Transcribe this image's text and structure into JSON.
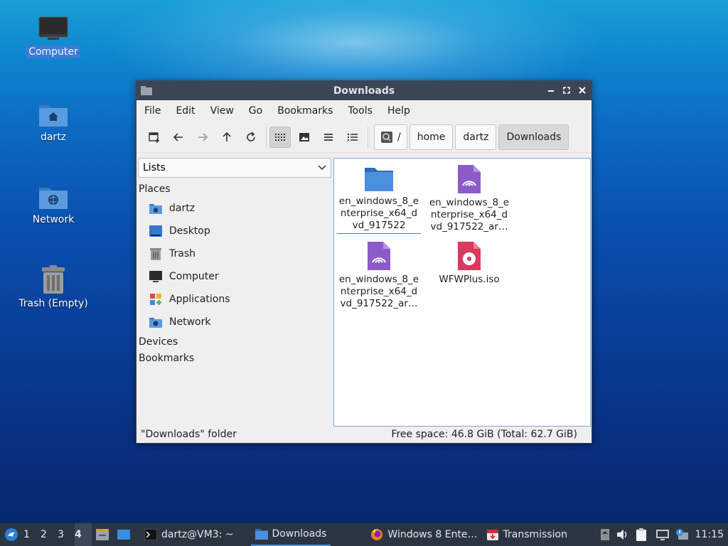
{
  "desktop": {
    "icons": [
      {
        "label": "Computer",
        "icon": "monitor-icon"
      },
      {
        "label": "dartz",
        "icon": "home-folder-icon"
      },
      {
        "label": "Network",
        "icon": "network-folder-icon"
      },
      {
        "label": "Trash (Empty)",
        "icon": "trash-icon"
      }
    ]
  },
  "window": {
    "title": "Downloads",
    "menu": [
      "File",
      "Edit",
      "View",
      "Go",
      "Bookmarks",
      "Tools",
      "Help"
    ],
    "breadcrumb": [
      "/",
      "home",
      "dartz",
      "Downloads"
    ],
    "side_pane": {
      "mode": "Lists",
      "sections": {
        "places": "Places",
        "devices": "Devices",
        "bookmarks": "Bookmarks"
      },
      "places": [
        {
          "label": "dartz",
          "icon": "home-folder-icon"
        },
        {
          "label": "Desktop",
          "icon": "desktop-icon"
        },
        {
          "label": "Trash",
          "icon": "trash-icon"
        },
        {
          "label": "Computer",
          "icon": "monitor-icon"
        },
        {
          "label": "Applications",
          "icon": "applications-icon"
        },
        {
          "label": "Network",
          "icon": "network-folder-icon"
        }
      ]
    },
    "files": [
      {
        "name": "en_windows_8_enterprise_x64_dvd_917522",
        "display": [
          "en_windows_8_e",
          "nterprise_x64_d",
          "vd_917522"
        ],
        "icon": "folder-icon"
      },
      {
        "name": "en_windows_8_enterprise_x64_dvd_917522_ar…",
        "display": [
          "en_windows_8_e",
          "nterprise_x64_d",
          "vd_917522_ar…"
        ],
        "icon": "torrent-icon"
      },
      {
        "name": "en_windows_8_enterprise_x64_dvd_917522_ar…",
        "display": [
          "en_windows_8_e",
          "nterprise_x64_d",
          "vd_917522_ar…"
        ],
        "icon": "torrent-icon"
      },
      {
        "name": "WFWPlus.iso",
        "display": [
          "WFWPlus.iso"
        ],
        "icon": "disc-image-icon"
      }
    ],
    "status": {
      "left": "\"Downloads\" folder",
      "right": "Free space: 46.8 GiB (Total: 62.7 GiB)"
    }
  },
  "taskbar": {
    "workspaces": [
      "1",
      "2",
      "3",
      "4"
    ],
    "active_workspace": "4",
    "tasks": [
      {
        "label": "dartz@VM3: ~",
        "icon": "terminal-icon"
      },
      {
        "label": "Downloads",
        "icon": "folder-icon"
      },
      {
        "label": "Windows 8 Ente…",
        "icon": "firefox-icon"
      },
      {
        "label": "Transmission",
        "icon": "transmission-icon"
      }
    ],
    "clock": "11:15"
  },
  "colors": {
    "titlebar": "#3b4555",
    "taskbar": "#2b3542",
    "selection": "#3d7bd6",
    "torrent": "#8d5bc9",
    "disc": "#d93a5d"
  }
}
